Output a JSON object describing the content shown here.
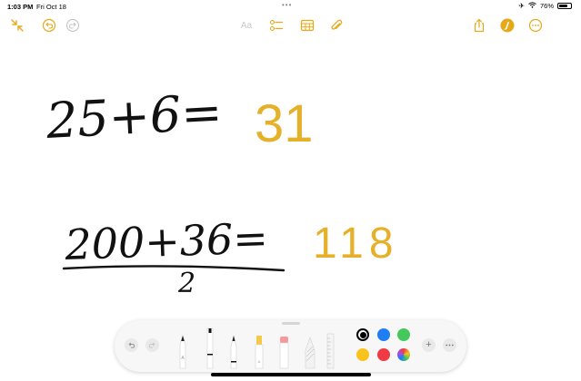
{
  "status_bar": {
    "time": "1:03 PM",
    "date": "Fri Oct 18",
    "battery_text": "76%",
    "battery_level": 0.76
  },
  "toolbar": {
    "font_label": "Aa",
    "icons": [
      "collapse-icon",
      "undo-icon",
      "redo-icon",
      "checklist-icon",
      "table-icon",
      "attachment-icon",
      "share-icon",
      "markup-icon",
      "more-icon"
    ]
  },
  "handwriting": {
    "line1": {
      "expression": "25+6=",
      "result": "31"
    },
    "line2": {
      "expression": "200+36=",
      "divisor": "2",
      "result": "118"
    }
  },
  "palette": {
    "tools": [
      "pen",
      "monoline",
      "fountain-pen",
      "highlighter",
      "eraser",
      "lasso",
      "ruler"
    ],
    "highlighter_color": "#f7c948",
    "colors": [
      "#000000",
      "#1e7ef2",
      "#44c85c",
      "#f9c31e",
      "#f03a44",
      "multicolor"
    ],
    "selected_color": "#000000",
    "accent": "#e6a817"
  }
}
